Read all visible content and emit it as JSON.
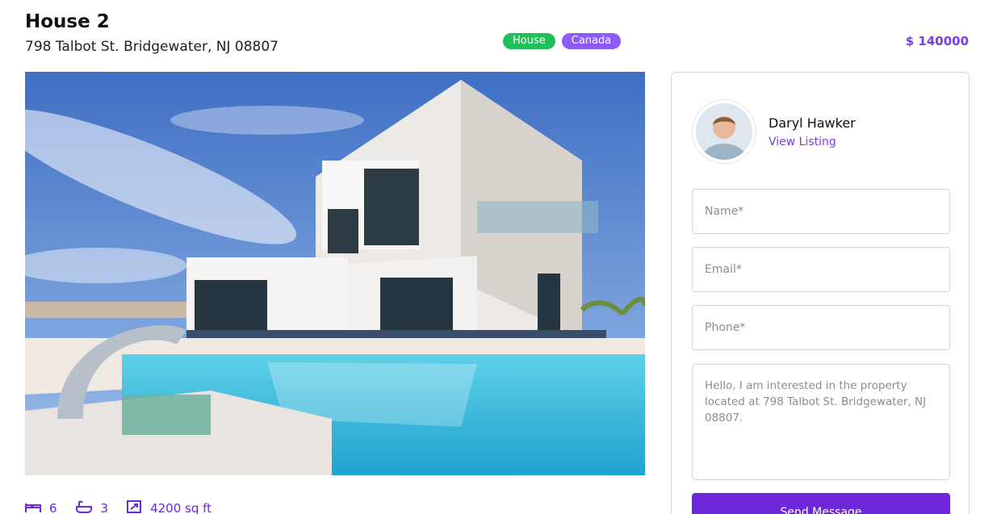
{
  "listing": {
    "title": "House 2",
    "address": "798 Talbot St. Bridgewater, NJ 08807",
    "tags": [
      "House",
      "Canada"
    ],
    "price": "$ 140000",
    "stats": {
      "beds": "6",
      "baths": "3",
      "area": "4200 sq ft"
    }
  },
  "agent": {
    "name": "Daryl Hawker",
    "link_label": "View Listing"
  },
  "form": {
    "name_placeholder": "Name*",
    "email_placeholder": "Email*",
    "phone_placeholder": "Phone*",
    "message_value": "Hello, I am interested in the property located at 798 Talbot St. Bridgewater, NJ 08807.",
    "submit_label": "Send Message"
  },
  "colors": {
    "accent": "#7c3aed",
    "tag_house": "#1fbf5a",
    "tag_country": "#8b5cf6",
    "button": "#6d28d9"
  },
  "icons": {
    "beds": "bed-icon",
    "baths": "bath-icon",
    "area": "area-icon"
  }
}
